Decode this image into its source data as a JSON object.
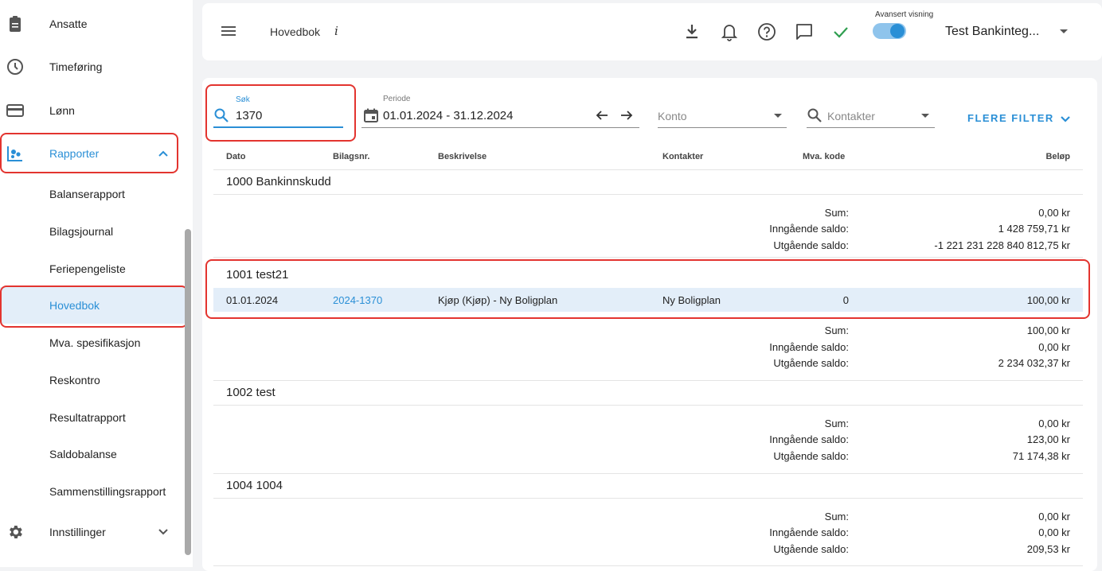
{
  "sidebar": {
    "items": [
      {
        "label": "Ansatte",
        "icon": "badge-icon"
      },
      {
        "label": "Timeføring",
        "icon": "clock-icon"
      },
      {
        "label": "Lønn",
        "icon": "card-icon"
      },
      {
        "label": "Rapporter",
        "icon": "reports-icon"
      }
    ],
    "sub_items": [
      "Balanserapport",
      "Bilagsjournal",
      "Feriepengeliste",
      "Hovedbok",
      "Mva. spesifikasjon",
      "Reskontro",
      "Resultatrapport",
      "Saldobalanse",
      "Sammenstillingsrapport"
    ],
    "settings": {
      "label": "Innstillinger",
      "icon": "gear-icon"
    }
  },
  "topbar": {
    "title": "Hovedbok",
    "info": "i",
    "advanced_label": "Avansert visning",
    "advanced_on": true,
    "company": "Test Bankinteg..."
  },
  "filters": {
    "search_label": "Søk",
    "search_value": "1370",
    "period_label": "Periode",
    "period_value": "01.01.2024 - 31.12.2024",
    "account_placeholder": "Konto",
    "contacts_placeholder": "Kontakter",
    "more_filters": "FLERE FILTER"
  },
  "table": {
    "headers": [
      "Dato",
      "Bilagsnr.",
      "Beskrivelse",
      "Kontakter",
      "Mva. kode",
      "Beløp"
    ],
    "sum_labels": [
      "Sum:",
      "Inngående saldo:",
      "Utgående saldo:"
    ],
    "groups": [
      {
        "title": "1000 Bankinnskudd",
        "sums": [
          "0,00 kr",
          "1 428 759,71 kr",
          "-1 221 231 228 840 812,75 kr"
        ]
      },
      {
        "title": "1001 test21",
        "sums": [
          "100,00 kr",
          "0,00 kr",
          "2 234 032,37 kr"
        ],
        "row": {
          "date": "01.01.2024",
          "voucher": "2024-1370",
          "description": "Kjøp (Kjøp) - Ny Boligplan",
          "contact": "Ny Boligplan",
          "vat": "0",
          "amount": "100,00 kr"
        }
      },
      {
        "title": "1002 test",
        "sums": [
          "0,00 kr",
          "123,00 kr",
          "71 174,38 kr"
        ]
      },
      {
        "title": "1004 1004",
        "sums": [
          "0,00 kr",
          "0,00 kr",
          "209,53 kr"
        ]
      }
    ]
  },
  "colors": {
    "accent": "#2a8fd6",
    "highlight": "#e3342f",
    "success": "#2e9e4f"
  }
}
